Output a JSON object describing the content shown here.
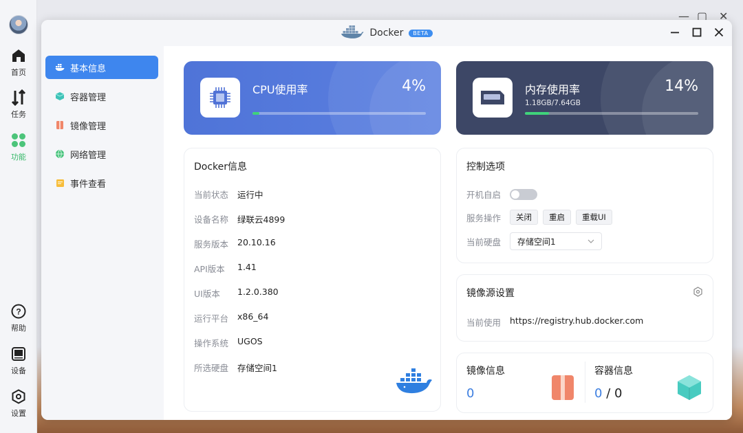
{
  "dock": {
    "items": [
      {
        "label": "首页",
        "icon": "home-icon"
      },
      {
        "label": "任务",
        "icon": "tasks-icon"
      },
      {
        "label": "功能",
        "icon": "apps-icon"
      },
      {
        "label": "帮助",
        "icon": "help-icon"
      },
      {
        "label": "设备",
        "icon": "device-icon"
      },
      {
        "label": "设置",
        "icon": "settings-icon"
      }
    ]
  },
  "window": {
    "title": "Docker",
    "badge": "BETA"
  },
  "sidebar": {
    "items": [
      {
        "label": "基本信息",
        "icon": "info-icon",
        "active": true
      },
      {
        "label": "容器管理",
        "icon": "container-icon"
      },
      {
        "label": "镜像管理",
        "icon": "image-icon"
      },
      {
        "label": "网络管理",
        "icon": "network-icon"
      },
      {
        "label": "事件查看",
        "icon": "event-icon"
      }
    ]
  },
  "cpu": {
    "label": "CPU使用率",
    "percent_text": "4%",
    "usage": 0.04
  },
  "memory": {
    "label": "内存使用率",
    "percent_text": "14%",
    "detail": "1.18GB/7.64GB",
    "usage": 0.14
  },
  "docker_info": {
    "title": "Docker信息",
    "rows": [
      {
        "key": "当前状态",
        "value": "运行中"
      },
      {
        "key": "设备名称",
        "value": "绿联云4899"
      },
      {
        "key": "服务版本",
        "value": "20.10.16"
      },
      {
        "key": "API版本",
        "value": "1.41"
      },
      {
        "key": "UI版本",
        "value": "1.2.0.380"
      },
      {
        "key": "运行平台",
        "value": "x86_64"
      },
      {
        "key": "操作系统",
        "value": "UGOS"
      },
      {
        "key": "所选硬盘",
        "value": "存储空间1"
      }
    ]
  },
  "control": {
    "title": "控制选项",
    "autostart_label": "开机自启",
    "autostart_on": false,
    "service_label": "服务操作",
    "buttons": {
      "stop": "关闭",
      "restart": "重启",
      "reload_ui": "重载UI"
    },
    "disk_label": "当前硬盘",
    "disk_value": "存储空间1"
  },
  "mirror": {
    "title": "镜像源设置",
    "current_label": "当前使用",
    "current_value": "https://registry.hub.docker.com"
  },
  "image_info": {
    "title": "镜像信息",
    "count": "0"
  },
  "container_info": {
    "title": "容器信息",
    "running": "0",
    "separator": "/",
    "total": "0"
  },
  "colors": {
    "accent": "#3e86ee",
    "cpu_card": "#5078db",
    "mem_card": "#3d4766",
    "progress": "#3fd37a",
    "active_green": "#38b96a"
  }
}
